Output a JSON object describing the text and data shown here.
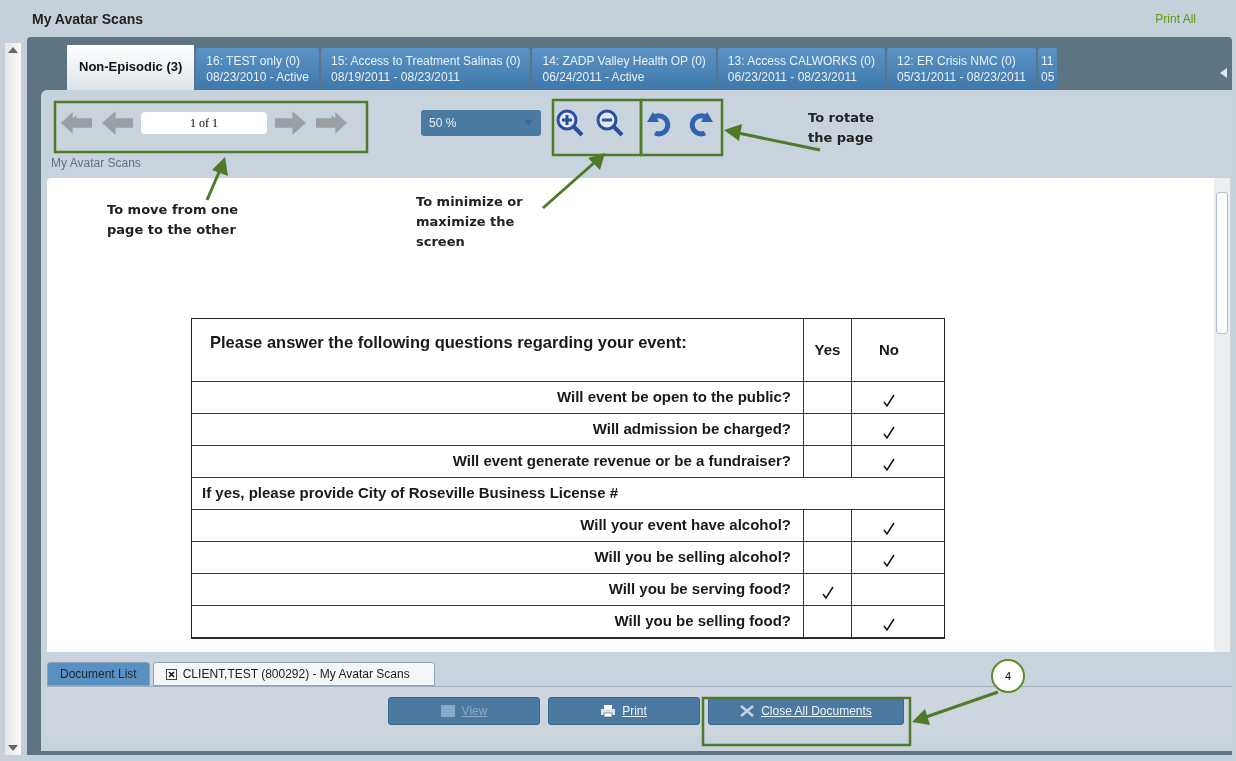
{
  "title": "My Avatar Scans",
  "print_all": "Print All",
  "tabs": [
    {
      "label": "Non-Episodic (3)",
      "selected": true
    },
    {
      "label": "16: TEST only (0)",
      "dates": "08/23/2010 - Active",
      "selected": false
    },
    {
      "label": "15: Access to Treatment Salinas (0)",
      "dates": "08/19/2011 - 08/23/2011",
      "selected": false
    },
    {
      "label": "14: ZADP Valley Health OP (0)",
      "dates": "06/24/2011 - Active",
      "selected": false
    },
    {
      "label": "13: Access CALWORKS (0)",
      "dates": "06/23/2011 - 08/23/2011",
      "selected": false
    },
    {
      "label": "12: ER Crisis NMC (0)",
      "dates": "05/31/2011 - 08/23/2011",
      "selected": false
    },
    {
      "label": "11",
      "dates": "05",
      "selected": false
    }
  ],
  "toolbar": {
    "page": "1 of 1",
    "zoom": "50 %"
  },
  "viewer_label": "My Avatar Scans",
  "document": {
    "heading": "Please answer the following questions regarding your event:",
    "yes": "Yes",
    "no": "No",
    "rows": [
      {
        "kind": "question",
        "text": "Will event be open to the public?",
        "yes_checked": false,
        "no_checked": true
      },
      {
        "kind": "question",
        "text": "Will admission be charged?",
        "yes_checked": false,
        "no_checked": true
      },
      {
        "kind": "question",
        "text": "Will event generate revenue or be a fundraiser?",
        "yes_checked": false,
        "no_checked": true
      },
      {
        "kind": "note",
        "text": "If yes, please provide City of Roseville Business License #"
      },
      {
        "kind": "question",
        "text": "Will your event have alcohol?",
        "yes_checked": false,
        "no_checked": true
      },
      {
        "kind": "question",
        "text": "Will you be selling alcohol?",
        "yes_checked": false,
        "no_checked": true
      },
      {
        "kind": "question",
        "text": "Will you be serving food?",
        "yes_checked": true,
        "no_checked": false
      },
      {
        "kind": "question",
        "text": "Will you be selling food?",
        "yes_checked": false,
        "no_checked": true
      }
    ]
  },
  "doc_tabs": [
    {
      "label": "Document List",
      "selected": false,
      "closable": false
    },
    {
      "label": "CLIENT,TEST (800292) - My Avatar Scans",
      "selected": true,
      "closable": true
    }
  ],
  "buttons": [
    {
      "label": "View",
      "disabled": true,
      "kind": "view"
    },
    {
      "label": "Print",
      "disabled": false,
      "kind": "print"
    },
    {
      "label": "Close All Documents",
      "disabled": false,
      "kind": "close"
    }
  ],
  "annotations": [
    "To move from one page to the other",
    "To minimize or maximize the screen",
    "To rotate the page"
  ],
  "callout": "4"
}
